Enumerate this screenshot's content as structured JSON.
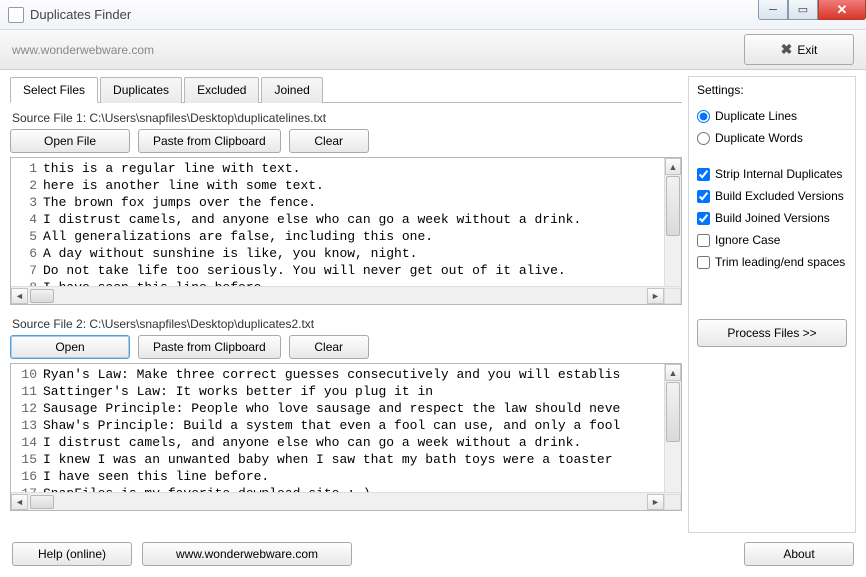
{
  "window": {
    "title": "Duplicates Finder"
  },
  "toolbar": {
    "url": "www.wonderwebware.com",
    "exit": "Exit"
  },
  "tabs": [
    "Select Files",
    "Duplicates",
    "Excluded",
    "Joined"
  ],
  "source1": {
    "label": "Source File 1: C:\\Users\\snapfiles\\Desktop\\duplicatelines.txt",
    "open": "Open File",
    "paste": "Paste from Clipboard",
    "clear": "Clear",
    "startLine": 1,
    "lines": [
      "this is a regular line with text.",
      "here is another line with some text.",
      "The brown fox jumps over the fence.",
      "I distrust camels, and anyone else who can go a week without a drink.",
      "All generalizations are false, including this one.",
      "A day without sunshine is like, you know, night.",
      "Do not take life too seriously. You will never get out of it alive.",
      "I have seen this line before."
    ]
  },
  "source2": {
    "label": "Source File 2: C:\\Users\\snapfiles\\Desktop\\duplicates2.txt",
    "open": "Open",
    "paste": "Paste from Clipboard",
    "clear": "Clear",
    "startLine": 10,
    "lines": [
      "Ryan's Law: Make three correct guesses consecutively and you will establis",
      "Sattinger's Law: It works better if you plug it in",
      "Sausage Principle: People who love sausage and respect the law should neve",
      "Shaw's Principle: Build a system that even a fool can use, and only a fool",
      "I distrust camels, and anyone else who can go a week without a drink.",
      "I knew I was an unwanted baby when I saw that my bath toys were a toaster",
      "I have seen this line before.",
      "SnapFiles is my favorite download site :-)"
    ]
  },
  "settings": {
    "head": "Settings:",
    "mode": {
      "lines": "Duplicate Lines",
      "words": "Duplicate Words",
      "selected": "lines"
    },
    "strip": {
      "label": "Strip Internal Duplicates",
      "checked": true
    },
    "excluded": {
      "label": "Build Excluded Versions",
      "checked": true
    },
    "joined": {
      "label": "Build Joined Versions",
      "checked": true
    },
    "ignorecase": {
      "label": "Ignore Case",
      "checked": false
    },
    "trim": {
      "label": "Trim leading/end spaces",
      "checked": false
    },
    "process": "Process Files  >>"
  },
  "footer": {
    "help": "Help (online)",
    "site": "www.wonderwebware.com",
    "about": "About"
  }
}
